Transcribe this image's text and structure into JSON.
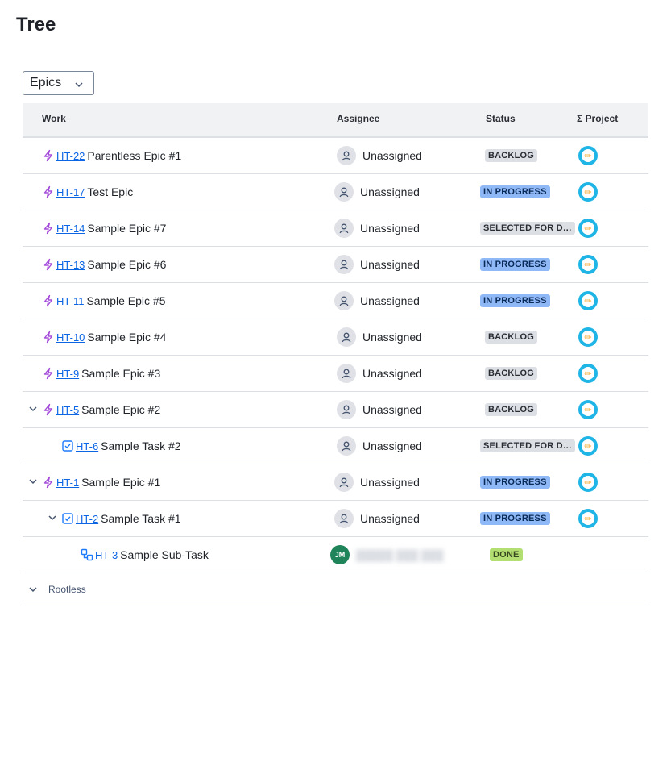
{
  "page": {
    "title": "Tree"
  },
  "filter": {
    "selected": "Epics"
  },
  "columns": {
    "work": "Work",
    "assignee": "Assignee",
    "status": "Status",
    "project": "Σ Project"
  },
  "rows": [
    {
      "key": "HT-22",
      "summary": "Parentless Epic #1",
      "assignee": "Unassigned",
      "status": "BACKLOG"
    },
    {
      "key": "HT-17",
      "summary": "Test Epic",
      "assignee": "Unassigned",
      "status": "IN PROGRESS"
    },
    {
      "key": "HT-14",
      "summary": "Sample Epic #7",
      "assignee": "Unassigned",
      "status": "SELECTED FOR DE..."
    },
    {
      "key": "HT-13",
      "summary": "Sample Epic #6",
      "assignee": "Unassigned",
      "status": "IN PROGRESS"
    },
    {
      "key": "HT-11",
      "summary": "Sample Epic #5",
      "assignee": "Unassigned",
      "status": "IN PROGRESS"
    },
    {
      "key": "HT-10",
      "summary": "Sample Epic #4",
      "assignee": "Unassigned",
      "status": "BACKLOG"
    },
    {
      "key": "HT-9",
      "summary": "Sample Epic #3",
      "assignee": "Unassigned",
      "status": "BACKLOG"
    },
    {
      "key": "HT-5",
      "summary": "Sample Epic #2",
      "assignee": "Unassigned",
      "status": "BACKLOG"
    },
    {
      "key": "HT-6",
      "summary": "Sample Task #2",
      "assignee": "Unassigned",
      "status": "SELECTED FOR DE..."
    },
    {
      "key": "HT-1",
      "summary": "Sample Epic #1",
      "assignee": "Unassigned",
      "status": "IN PROGRESS"
    },
    {
      "key": "HT-2",
      "summary": "Sample Task #1",
      "assignee": "Unassigned",
      "status": "IN PROGRESS"
    },
    {
      "key": "HT-3",
      "summary": "Sample Sub-Task",
      "assignee_initials": "JM",
      "status": "DONE"
    }
  ],
  "rootless": {
    "label": "Rootless"
  },
  "icons": {
    "epic": "lightning-icon",
    "task": "checkbox-icon",
    "subtask": "subtask-icon",
    "user": "user-icon",
    "project": "project-avatar-icon",
    "expand": "chevron-down-icon"
  },
  "colors": {
    "link": "#0c66e4",
    "epic": "#a54bd9",
    "task": "#1d7afc",
    "in_progress_bg": "#8fb8f6",
    "backlog_bg": "#dcdfe4",
    "done_bg": "#b3df72",
    "avatar_jm": "#1f845a",
    "project_ring": "#1fb5e6"
  }
}
